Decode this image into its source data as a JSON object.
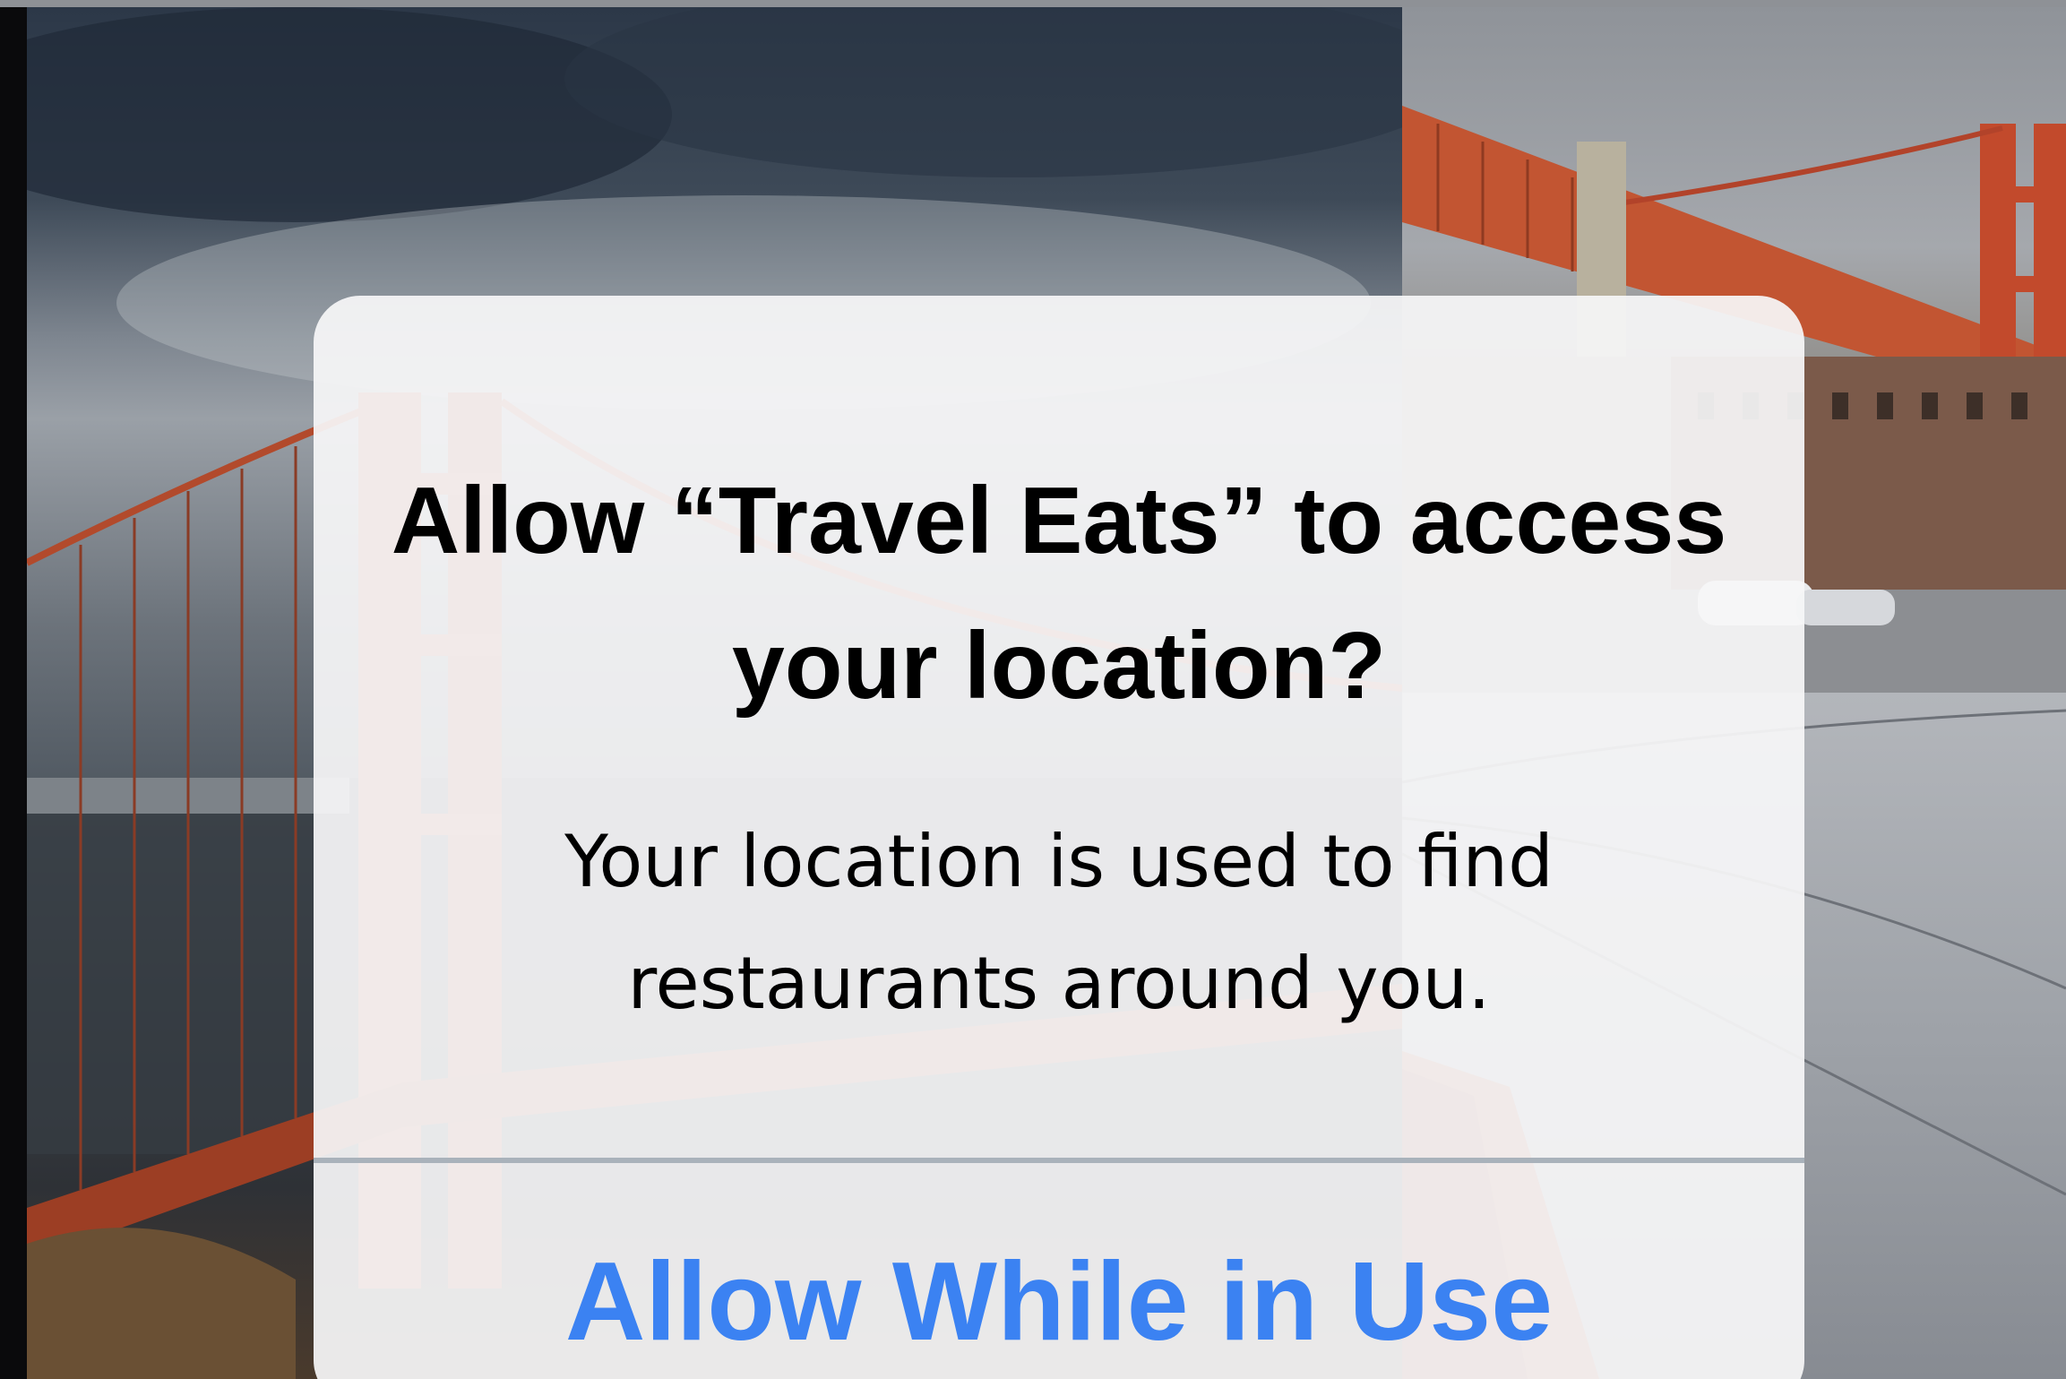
{
  "alert": {
    "title": "Allow “Travel Eats” to access your location?",
    "message": "Your location is used to find restaurants around you.",
    "primary_button_label": "Allow While in Use",
    "accent_color": "#3b82f2"
  },
  "background": {
    "tiles": [
      {
        "description_icon": "bridge-fog-photo"
      },
      {
        "description_icon": "bridge-fort-photo"
      },
      {
        "description_icon": "bridge-tower-photo"
      }
    ]
  }
}
